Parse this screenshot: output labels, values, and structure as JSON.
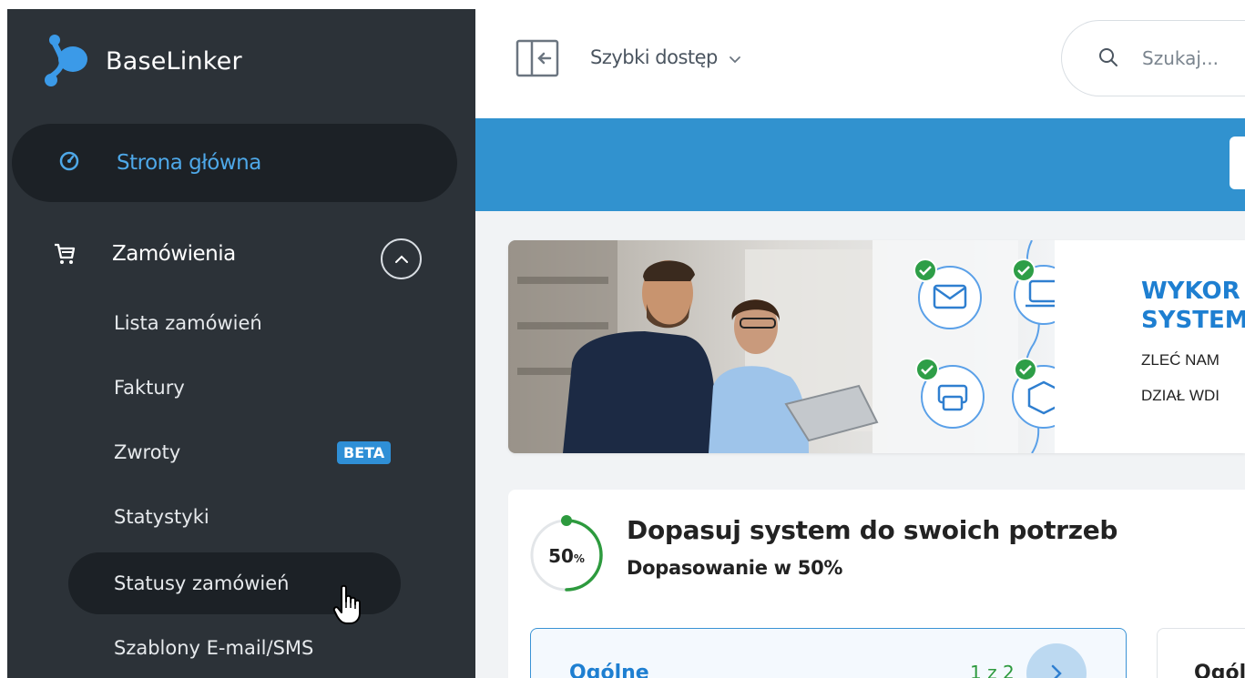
{
  "colors": {
    "sidebar_bg": "#2c3238",
    "sidebar_active_bg": "#1c2126",
    "accent_blue": "#3192cf",
    "link_blue": "#1e7fd1",
    "success_green": "#2d9a3e",
    "beta_badge": "#2f8fd6"
  },
  "sidebar": {
    "brand": "BaseLinker",
    "home": {
      "label": "Strona główna",
      "icon": "dashboard-gauge-icon"
    },
    "orders": {
      "label": "Zamówienia",
      "icon": "cart-icon",
      "expanded": true,
      "items": [
        {
          "label": "Lista zamówień"
        },
        {
          "label": "Faktury"
        },
        {
          "label": "Zwroty",
          "badge": "BETA"
        },
        {
          "label": "Statystyki"
        },
        {
          "label": "Statusy zamówień",
          "hovered": true
        },
        {
          "label": "Szablony E-mail/SMS"
        }
      ]
    }
  },
  "header": {
    "quick_access": "Szybki dostęp",
    "search_placeholder": "Szukaj..."
  },
  "banner": {
    "title_line1": "WYKOR",
    "title_line2": "SYSTEM",
    "line1": "ZLEĆ NAM",
    "line2": "DZIAŁ WDI"
  },
  "setup": {
    "progress_percent": 50,
    "progress_label": "50",
    "percent_sign": "%",
    "title": "Dopasuj system do swoich potrzeb",
    "subtitle": "Dopasowanie w 50%",
    "step1": {
      "name": "Ogólne",
      "count": "1 z 2"
    },
    "step2": {
      "name": "Ogól"
    }
  }
}
